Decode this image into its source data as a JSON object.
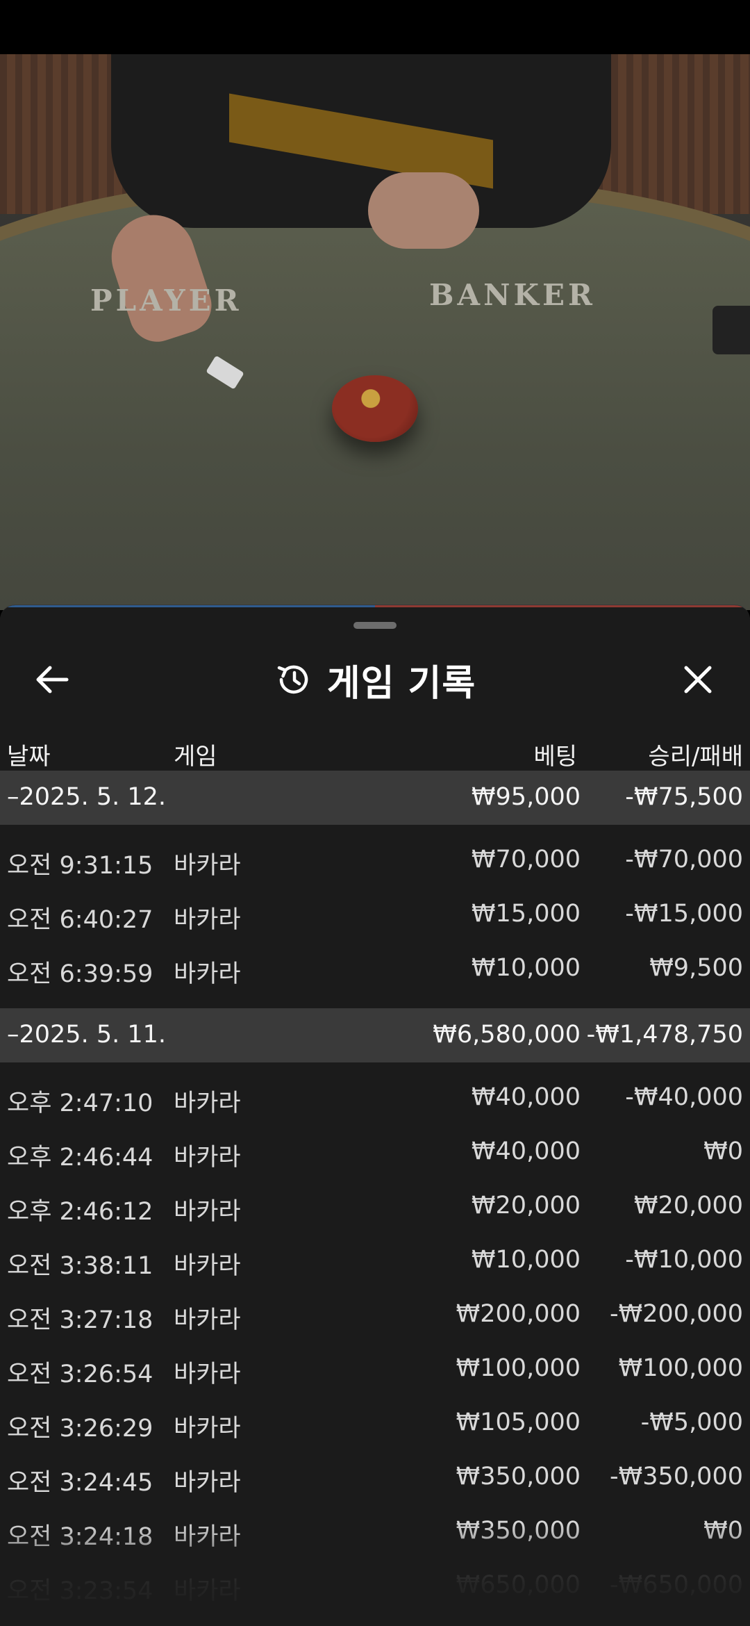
{
  "video": {
    "player_label": "PLAYER",
    "banker_label": "BANKER"
  },
  "panel": {
    "title": "게임 기록",
    "back_icon": "arrow-left-icon",
    "history_icon": "history-icon",
    "close_icon": "close-icon"
  },
  "columns": {
    "date": "날짜",
    "game": "게임",
    "bet": "베팅",
    "win_loss": "승리/패배"
  },
  "groups": [
    {
      "date": "–2025. 5. 12.",
      "total_bet": "₩95,000",
      "total_result": "-₩75,500",
      "rows": [
        {
          "time": "오전 9:31:15",
          "game": "바카라",
          "bet": "₩70,000",
          "result": "-₩70,000"
        },
        {
          "time": "오전 6:40:27",
          "game": "바카라",
          "bet": "₩15,000",
          "result": "-₩15,000"
        },
        {
          "time": "오전 6:39:59",
          "game": "바카라",
          "bet": "₩10,000",
          "result": "₩9,500"
        }
      ]
    },
    {
      "date": "–2025. 5. 11.",
      "total_bet": "₩6,580,000",
      "total_result": "-₩1,478,750",
      "rows": [
        {
          "time": "오후 2:47:10",
          "game": "바카라",
          "bet": "₩40,000",
          "result": "-₩40,000"
        },
        {
          "time": "오후 2:46:44",
          "game": "바카라",
          "bet": "₩40,000",
          "result": "₩0"
        },
        {
          "time": "오후 2:46:12",
          "game": "바카라",
          "bet": "₩20,000",
          "result": "₩20,000"
        },
        {
          "time": "오전 3:38:11",
          "game": "바카라",
          "bet": "₩10,000",
          "result": "-₩10,000"
        },
        {
          "time": "오전 3:27:18",
          "game": "바카라",
          "bet": "₩200,000",
          "result": "-₩200,000"
        },
        {
          "time": "오전 3:26:54",
          "game": "바카라",
          "bet": "₩100,000",
          "result": "₩100,000"
        },
        {
          "time": "오전 3:26:29",
          "game": "바카라",
          "bet": "₩105,000",
          "result": "-₩5,000"
        },
        {
          "time": "오전 3:24:45",
          "game": "바카라",
          "bet": "₩350,000",
          "result": "-₩350,000"
        },
        {
          "time": "오전 3:24:18",
          "game": "바카라",
          "bet": "₩350,000",
          "result": "₩0"
        },
        {
          "time": "오전 3:23:54",
          "game": "바카라",
          "bet": "₩650,000",
          "result": "-₩650,000"
        }
      ]
    }
  ]
}
